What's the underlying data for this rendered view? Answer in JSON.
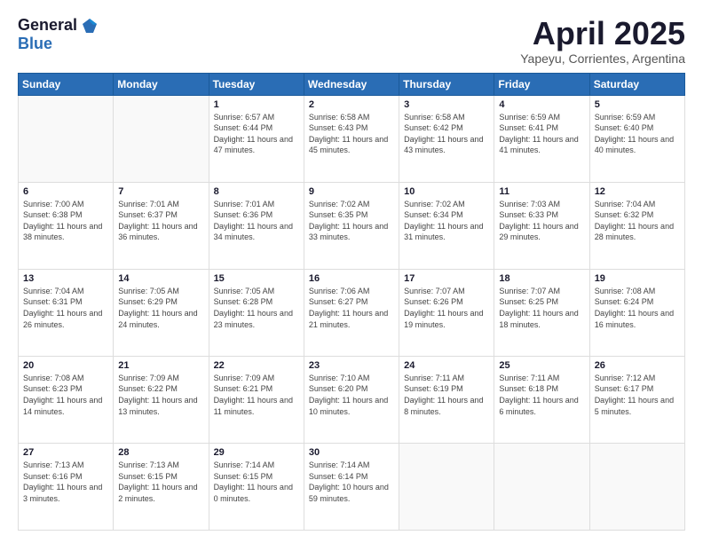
{
  "header": {
    "logo_general": "General",
    "logo_blue": "Blue",
    "month_title": "April 2025",
    "subtitle": "Yapeyu, Corrientes, Argentina"
  },
  "weekdays": [
    "Sunday",
    "Monday",
    "Tuesday",
    "Wednesday",
    "Thursday",
    "Friday",
    "Saturday"
  ],
  "weeks": [
    [
      {
        "day": "",
        "info": ""
      },
      {
        "day": "",
        "info": ""
      },
      {
        "day": "1",
        "info": "Sunrise: 6:57 AM\nSunset: 6:44 PM\nDaylight: 11 hours and 47 minutes."
      },
      {
        "day": "2",
        "info": "Sunrise: 6:58 AM\nSunset: 6:43 PM\nDaylight: 11 hours and 45 minutes."
      },
      {
        "day": "3",
        "info": "Sunrise: 6:58 AM\nSunset: 6:42 PM\nDaylight: 11 hours and 43 minutes."
      },
      {
        "day": "4",
        "info": "Sunrise: 6:59 AM\nSunset: 6:41 PM\nDaylight: 11 hours and 41 minutes."
      },
      {
        "day": "5",
        "info": "Sunrise: 6:59 AM\nSunset: 6:40 PM\nDaylight: 11 hours and 40 minutes."
      }
    ],
    [
      {
        "day": "6",
        "info": "Sunrise: 7:00 AM\nSunset: 6:38 PM\nDaylight: 11 hours and 38 minutes."
      },
      {
        "day": "7",
        "info": "Sunrise: 7:01 AM\nSunset: 6:37 PM\nDaylight: 11 hours and 36 minutes."
      },
      {
        "day": "8",
        "info": "Sunrise: 7:01 AM\nSunset: 6:36 PM\nDaylight: 11 hours and 34 minutes."
      },
      {
        "day": "9",
        "info": "Sunrise: 7:02 AM\nSunset: 6:35 PM\nDaylight: 11 hours and 33 minutes."
      },
      {
        "day": "10",
        "info": "Sunrise: 7:02 AM\nSunset: 6:34 PM\nDaylight: 11 hours and 31 minutes."
      },
      {
        "day": "11",
        "info": "Sunrise: 7:03 AM\nSunset: 6:33 PM\nDaylight: 11 hours and 29 minutes."
      },
      {
        "day": "12",
        "info": "Sunrise: 7:04 AM\nSunset: 6:32 PM\nDaylight: 11 hours and 28 minutes."
      }
    ],
    [
      {
        "day": "13",
        "info": "Sunrise: 7:04 AM\nSunset: 6:31 PM\nDaylight: 11 hours and 26 minutes."
      },
      {
        "day": "14",
        "info": "Sunrise: 7:05 AM\nSunset: 6:29 PM\nDaylight: 11 hours and 24 minutes."
      },
      {
        "day": "15",
        "info": "Sunrise: 7:05 AM\nSunset: 6:28 PM\nDaylight: 11 hours and 23 minutes."
      },
      {
        "day": "16",
        "info": "Sunrise: 7:06 AM\nSunset: 6:27 PM\nDaylight: 11 hours and 21 minutes."
      },
      {
        "day": "17",
        "info": "Sunrise: 7:07 AM\nSunset: 6:26 PM\nDaylight: 11 hours and 19 minutes."
      },
      {
        "day": "18",
        "info": "Sunrise: 7:07 AM\nSunset: 6:25 PM\nDaylight: 11 hours and 18 minutes."
      },
      {
        "day": "19",
        "info": "Sunrise: 7:08 AM\nSunset: 6:24 PM\nDaylight: 11 hours and 16 minutes."
      }
    ],
    [
      {
        "day": "20",
        "info": "Sunrise: 7:08 AM\nSunset: 6:23 PM\nDaylight: 11 hours and 14 minutes."
      },
      {
        "day": "21",
        "info": "Sunrise: 7:09 AM\nSunset: 6:22 PM\nDaylight: 11 hours and 13 minutes."
      },
      {
        "day": "22",
        "info": "Sunrise: 7:09 AM\nSunset: 6:21 PM\nDaylight: 11 hours and 11 minutes."
      },
      {
        "day": "23",
        "info": "Sunrise: 7:10 AM\nSunset: 6:20 PM\nDaylight: 11 hours and 10 minutes."
      },
      {
        "day": "24",
        "info": "Sunrise: 7:11 AM\nSunset: 6:19 PM\nDaylight: 11 hours and 8 minutes."
      },
      {
        "day": "25",
        "info": "Sunrise: 7:11 AM\nSunset: 6:18 PM\nDaylight: 11 hours and 6 minutes."
      },
      {
        "day": "26",
        "info": "Sunrise: 7:12 AM\nSunset: 6:17 PM\nDaylight: 11 hours and 5 minutes."
      }
    ],
    [
      {
        "day": "27",
        "info": "Sunrise: 7:13 AM\nSunset: 6:16 PM\nDaylight: 11 hours and 3 minutes."
      },
      {
        "day": "28",
        "info": "Sunrise: 7:13 AM\nSunset: 6:15 PM\nDaylight: 11 hours and 2 minutes."
      },
      {
        "day": "29",
        "info": "Sunrise: 7:14 AM\nSunset: 6:15 PM\nDaylight: 11 hours and 0 minutes."
      },
      {
        "day": "30",
        "info": "Sunrise: 7:14 AM\nSunset: 6:14 PM\nDaylight: 10 hours and 59 minutes."
      },
      {
        "day": "",
        "info": ""
      },
      {
        "day": "",
        "info": ""
      },
      {
        "day": "",
        "info": ""
      }
    ]
  ]
}
